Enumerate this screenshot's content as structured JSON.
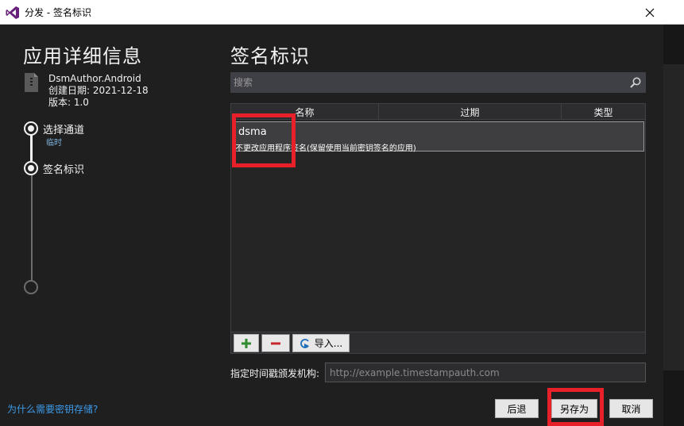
{
  "window": {
    "title": "分发 - 签名标识",
    "close_glyph": "✕",
    "accent": "#68217a"
  },
  "left": {
    "heading": "应用详细信息",
    "app_name": "DsmAuthor.Android",
    "created": "创建日期: 2021-12-18",
    "version": "版本: 1.0",
    "steps": [
      {
        "label": "选择通道",
        "sub": "临时"
      },
      {
        "label": "签名标识"
      }
    ],
    "help_link": "为什么需要密钥存储?"
  },
  "right": {
    "heading": "签名标识",
    "search_placeholder": "搜索",
    "columns": [
      "名称",
      "过期",
      "类型"
    ],
    "rows": [
      {
        "name": "dsma",
        "description": "不更改应用程序签名(保留使用当前密钥签名的应用)"
      }
    ],
    "toolbar": {
      "add": "+",
      "remove": "−",
      "import_label": "导入..."
    },
    "timestamp_label": "指定时间戳颁发机构:",
    "timestamp_placeholder": "http://example.timestampauth.com"
  },
  "buttons": {
    "back": "后退",
    "save_as": "另存为",
    "cancel": "取消"
  },
  "colors": {
    "highlight": "#e8202a",
    "link": "#3d9be9",
    "add_green": "#2e8b2e",
    "remove_red": "#c8262d"
  }
}
